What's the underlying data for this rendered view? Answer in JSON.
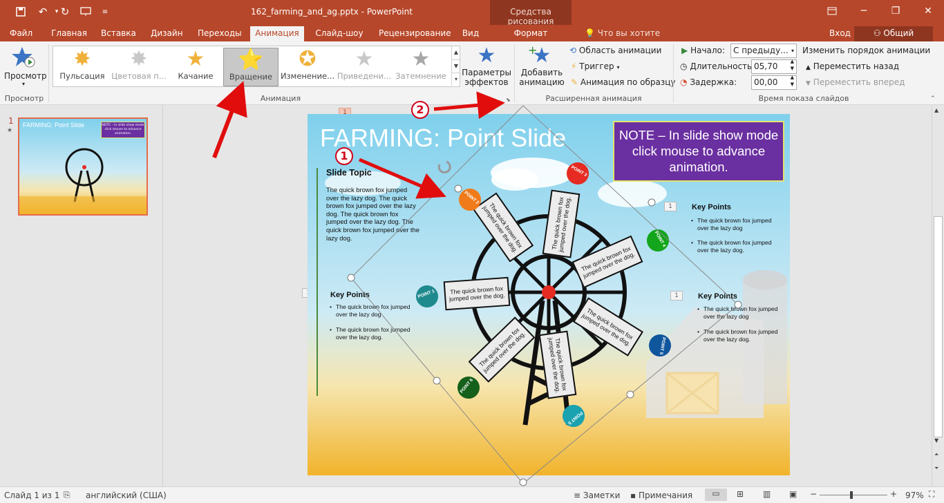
{
  "window": {
    "title": "162_farming_and_ag.pptx - PowerPoint",
    "context_group": "Средства рисования"
  },
  "tabs": [
    "Файл",
    "Главная",
    "Вставка",
    "Дизайн",
    "Переходы",
    "Анимация",
    "Слайд-шоу",
    "Рецензирование",
    "Вид",
    "Формат"
  ],
  "active_tab": "Анимация",
  "tell_me": "Что вы хотите сделать?",
  "signin": "Вход",
  "share": "Общий доступ",
  "ribbon": {
    "preview": {
      "label": "Просмотр",
      "group": "Просмотр"
    },
    "animation_group": "Анимация",
    "gallery": [
      {
        "label": "Пульсация",
        "color": "#f0b13b",
        "disabled": false
      },
      {
        "label": "Цветовая п...",
        "color": "#c8c8c8",
        "disabled": true
      },
      {
        "label": "Качание",
        "color": "#f0b13b",
        "disabled": false
      },
      {
        "label": "Вращение",
        "color": "#f0b13b",
        "disabled": false,
        "selected": true
      },
      {
        "label": "Изменение...",
        "color": "#f0b13b",
        "disabled": false
      },
      {
        "label": "Приведени...",
        "color": "#c8c8c8",
        "disabled": true
      },
      {
        "label": "Затемнение",
        "color": "#a7a7a7",
        "disabled": true
      }
    ],
    "effect_options": {
      "line1": "Параметры",
      "line2": "эффектов"
    },
    "advanced": {
      "group": "Расширенная анимация",
      "add_line1": "Добавить",
      "add_line2": "анимацию",
      "pane": "Область анимации",
      "trigger": "Триггер",
      "painter": "Анимация по образцу"
    },
    "timing": {
      "group": "Время показа слайдов",
      "start_label": "Начало:",
      "start_value": "С предыду...",
      "duration_label": "Длительность:",
      "duration_value": "05,70",
      "delay_label": "Задержка:",
      "delay_value": "00,00",
      "reorder": "Изменить порядок анимации",
      "move_earlier": "Переместить назад",
      "move_later": "Переместить вперед"
    }
  },
  "thumbnail": {
    "number": "1",
    "title": "FARMING: Point Slide",
    "note": "NOTE – In slide show mode click mouse to advance animation."
  },
  "slide": {
    "title": "FARMING: Point Slide",
    "note": "NOTE – In slide show mode click mouse to advance animation.",
    "topic_title": "Slide Topic",
    "topic_text": "The quick brown fox jumped over the lazy dog. The quick brown fox jumped over the lazy dog. The quick brown fox jumped over the lazy dog. The quick brown fox jumped over the lazy dog.",
    "key_points_title": "Key Points",
    "bullet1": "The quick brown fox jumped over the lazy dog",
    "bullet2": "The quick brown fox jumped over the lazy dog.",
    "card_text": "The quick brown fox jumped over the dog.",
    "anim_tag": "1",
    "points": [
      {
        "label": "POINT 1",
        "color": "#1f8a8e"
      },
      {
        "label": "POINT 2",
        "color": "#f07b1b"
      },
      {
        "label": "POINT 3",
        "color": "#e52b22"
      },
      {
        "label": "POINT 4",
        "color": "#13a51b"
      },
      {
        "label": "POINT 5",
        "color": "#10569d"
      },
      {
        "label": "POINT 5",
        "color": "#1aa2b0"
      },
      {
        "label": "POINT 6",
        "color": "#15601a"
      }
    ]
  },
  "callouts": [
    "1",
    "2"
  ],
  "status": {
    "slide": "Слайд 1 из 1",
    "language": "английский (США)",
    "notes": "Заметки",
    "comments": "Примечания",
    "zoom": "97%"
  }
}
